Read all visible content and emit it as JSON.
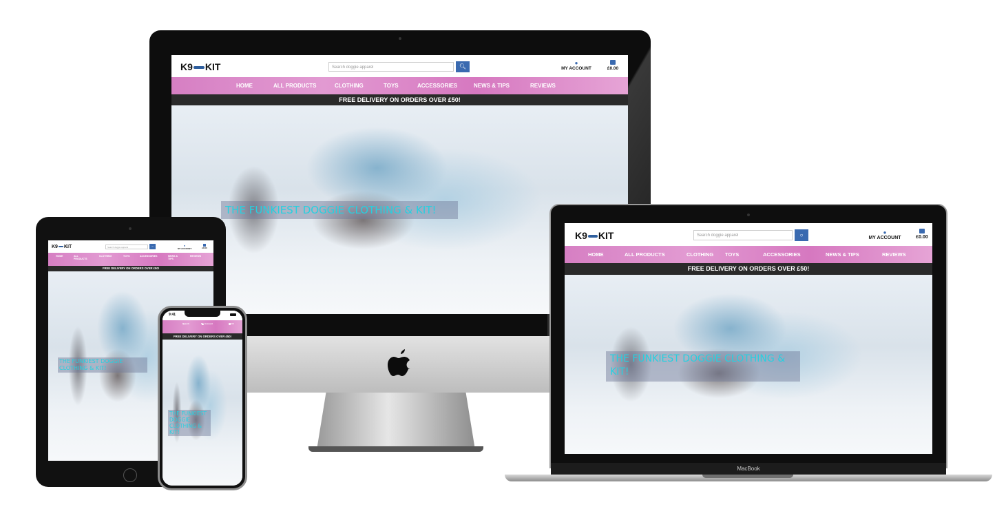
{
  "site": {
    "logo_left": "K9",
    "logo_right": "KIT",
    "search_placeholder": "Search doggie apparel",
    "account_label": "MY ACCOUNT",
    "basket_total": "£0.00",
    "nav": [
      "HOME",
      "ALL PRODUCTS",
      "CLOTHING",
      "TOYS",
      "ACCESSORIES",
      "NEWS & TIPS",
      "REVIEWS"
    ],
    "delivery_banner": "FREE DELIVERY ON ORDERS OVER £50!",
    "hero_text": "THE FUNKIEST DOGGIE CLOTHING & KIT!"
  },
  "phone": {
    "time": "9:41",
    "search_label": "Search",
    "account_label": "My Account",
    "basket_total": "£0.00"
  },
  "device_labels": {
    "laptop_brand": "MacBook"
  },
  "colors": {
    "nav_pink": "#d67fc3",
    "banner_dark": "#2a2a2a",
    "hero_text": "#26d0e0",
    "search_blue": "#3a6ab0",
    "logo_bone": "#2f5f9e"
  }
}
